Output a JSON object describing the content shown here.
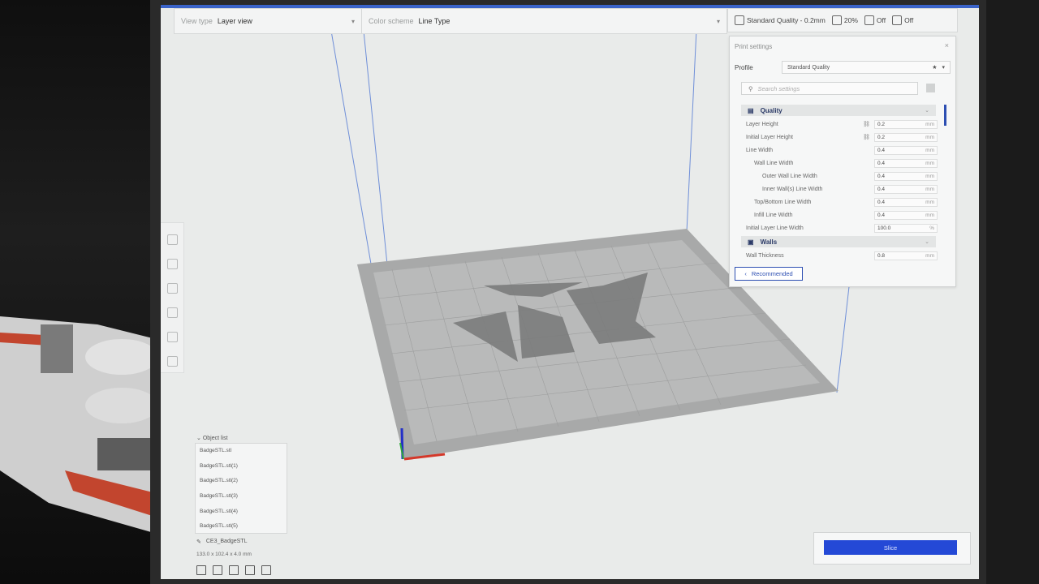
{
  "view_bar": {
    "view_type_label": "View type",
    "view_type_value": "Layer view",
    "color_scheme_label": "Color scheme",
    "color_scheme_value": "Line Type"
  },
  "quality_bar": {
    "profile": "Standard Quality - 0.2mm",
    "infill": "20%",
    "support": "Off",
    "adhesion": "Off"
  },
  "print_settings": {
    "title": "Print settings",
    "profile_label": "Profile",
    "profile_value": "Standard Quality",
    "search_placeholder": "Search settings",
    "categories": {
      "quality": "Quality",
      "walls": "Walls"
    },
    "settings": [
      {
        "name": "Layer Height",
        "value": "0.2",
        "unit": "mm"
      },
      {
        "name": "Initial Layer Height",
        "value": "0.2",
        "unit": "mm"
      },
      {
        "name": "Line Width",
        "value": "0.4",
        "unit": "mm"
      },
      {
        "name": "Wall Line Width",
        "value": "0.4",
        "unit": "mm"
      },
      {
        "name": "Outer Wall Line Width",
        "value": "0.4",
        "unit": "mm"
      },
      {
        "name": "Inner Wall(s) Line Width",
        "value": "0.4",
        "unit": "mm"
      },
      {
        "name": "Top/Bottom Line Width",
        "value": "0.4",
        "unit": "mm"
      },
      {
        "name": "Infill Line Width",
        "value": "0.4",
        "unit": "mm"
      },
      {
        "name": "Initial Layer Line Width",
        "value": "100.0",
        "unit": "%"
      }
    ],
    "walls_settings": [
      {
        "name": "Wall Thickness",
        "value": "0.8",
        "unit": "mm"
      }
    ],
    "recommended_button": "Recommended"
  },
  "object_list": {
    "title": "Object list",
    "items": [
      "BadgeSTL.stl",
      "BadgeSTL.stl(1)",
      "BadgeSTL.stl(2)",
      "BadgeSTL.stl(3)",
      "BadgeSTL.stl(4)",
      "BadgeSTL.stl(5)"
    ]
  },
  "job": {
    "name": "CE3_BadgeSTL",
    "dimensions": "133.0 x 102.4 x 4.0 mm"
  },
  "slice_button": "Slice",
  "colors": {
    "accent": "#2449d6",
    "category_text": "#2b3a67",
    "build_plate": "#a8a9a9"
  }
}
